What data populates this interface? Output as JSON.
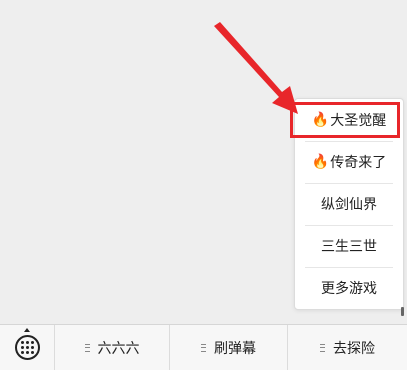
{
  "popup_menu": {
    "items": [
      {
        "label": "大圣觉醒",
        "icon": "fire-icon",
        "hot": true
      },
      {
        "label": "传奇来了",
        "icon": "fire-icon",
        "hot": true
      },
      {
        "label": "纵剑仙界",
        "hot": false
      },
      {
        "label": "三生三世",
        "hot": false
      },
      {
        "label": "更多游戏",
        "hot": false
      }
    ]
  },
  "bottom_bar": {
    "keyboard_icon": "keyboard-icon",
    "tabs": [
      {
        "label": "六六六"
      },
      {
        "label": "刷弹幕"
      },
      {
        "label": "去探险"
      }
    ]
  },
  "colors": {
    "annotation_red": "#e8262a",
    "background": "#eeeeee",
    "menu_bg": "#ffffff"
  }
}
